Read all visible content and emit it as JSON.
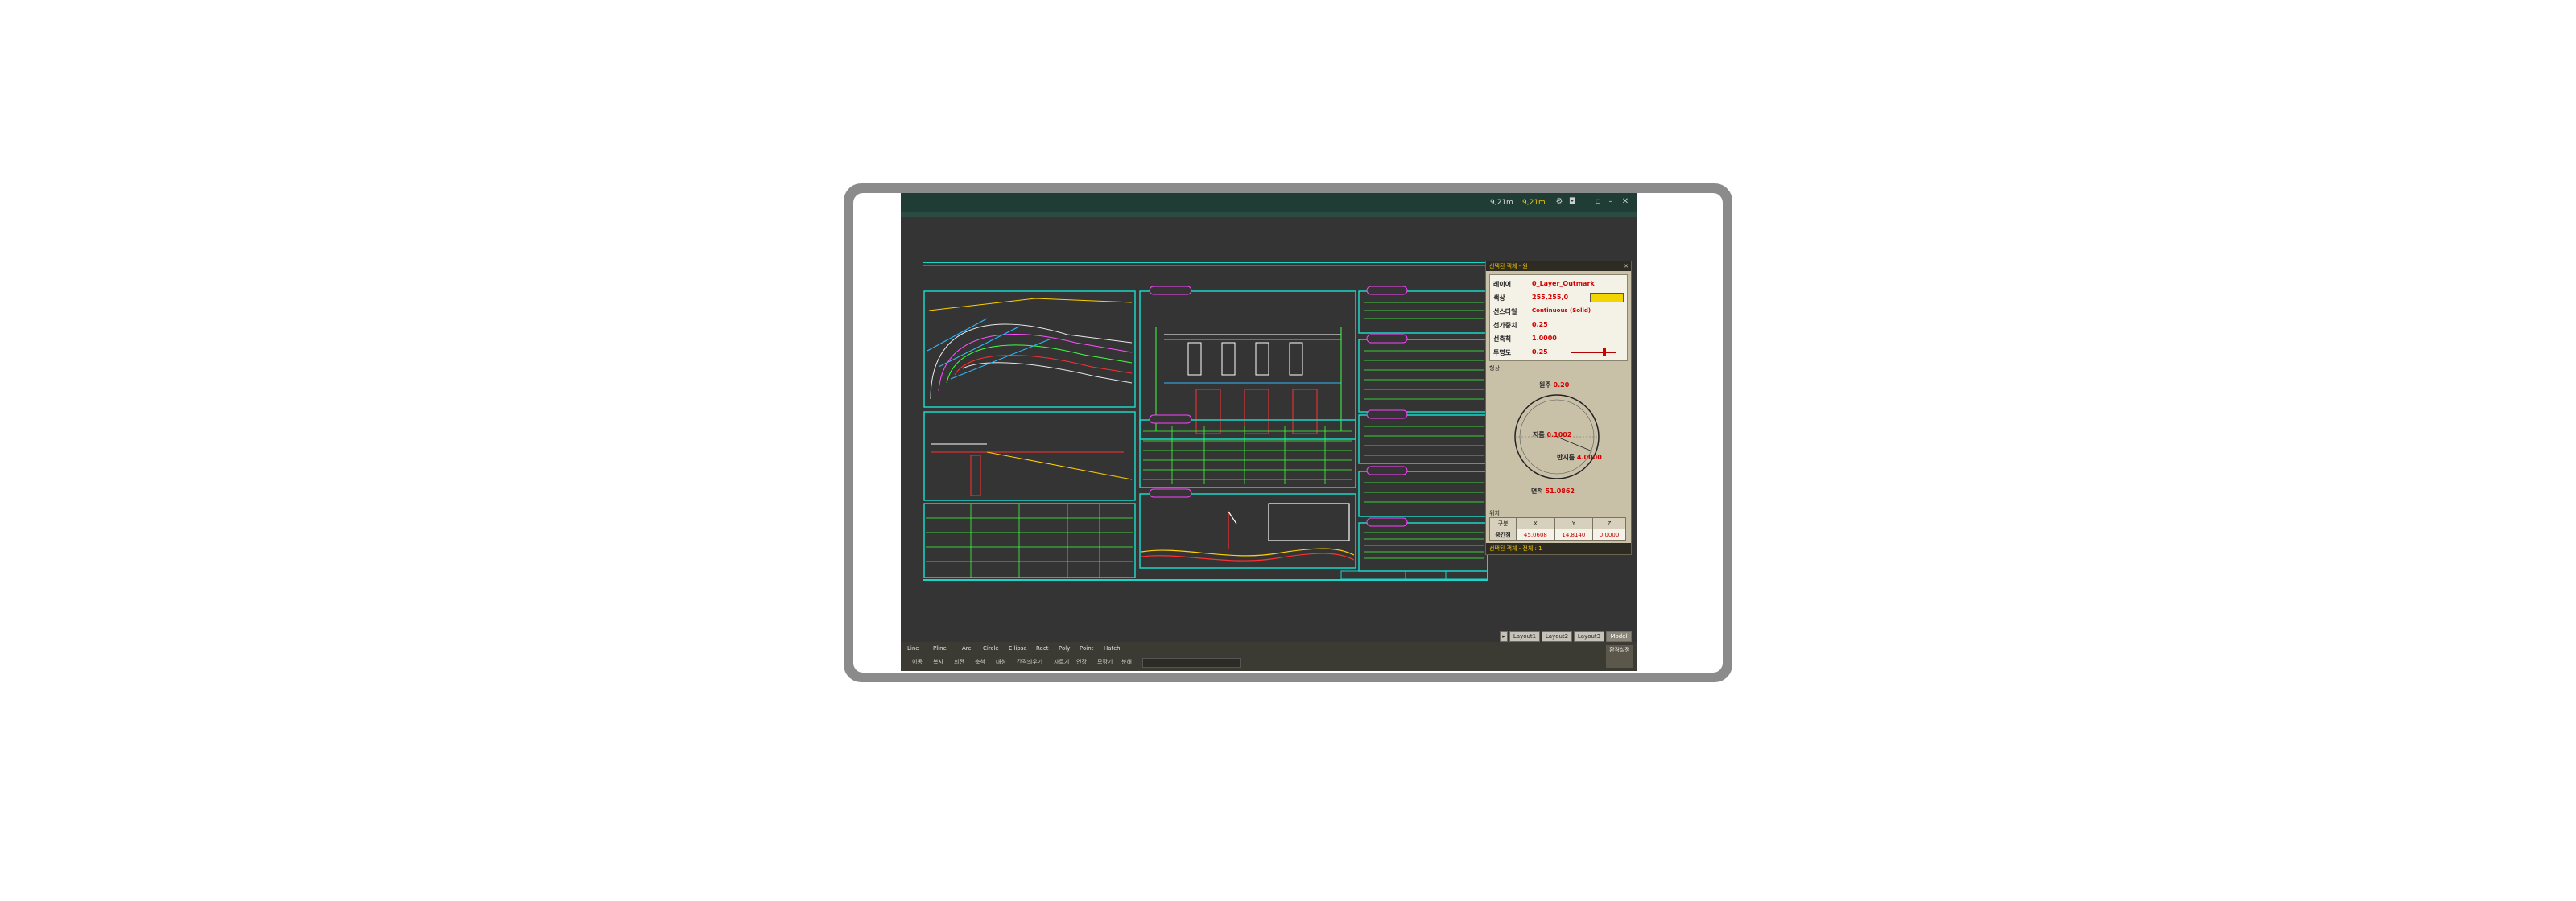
{
  "window": {
    "status_left": "9,21m",
    "status_right": "9,21m"
  },
  "panel": {
    "title": "선택된 객체 - 원",
    "properties": [
      {
        "key": "레이어",
        "value": "0_Layer_Outmark"
      },
      {
        "key": "색상",
        "value": "255,255,0"
      },
      {
        "key": "선스타일",
        "value": "Continuous (Solid)"
      },
      {
        "key": "선가중치",
        "value": "0.25"
      },
      {
        "key": "선축척",
        "value": "1.0000"
      },
      {
        "key": "투명도",
        "value": "0.25"
      }
    ],
    "color_swatch": "#f2d500",
    "section_geometry": "형상",
    "diameter_label": "원주",
    "diameter_value": "0.20",
    "center_label": "지름",
    "center_value": "0.1002",
    "radius_label": "반지름",
    "radius_value": "4.0000",
    "area_label": "면적",
    "area_value": "51.0862",
    "section_position": "위치",
    "table": {
      "headers": [
        "구분",
        "X",
        "Y",
        "Z"
      ],
      "row": [
        "중간점",
        "45.0608",
        "14.8140",
        "0.0000"
      ]
    },
    "footer": "선택된 객체 - 전체 : 1"
  },
  "tabs": [
    "Layout1",
    "Layout2",
    "Layout3"
  ],
  "model_tab": "Model",
  "menu": {
    "row1": [
      "Line",
      "Pline",
      "Arc",
      "Circle",
      "Ellipse",
      "Rect",
      "Poly",
      "Point",
      "Hatch"
    ],
    "row2": [
      "이동",
      "복사",
      "회전",
      "축척",
      "대칭",
      "간격띄우기",
      "자르기",
      "연장",
      "모깎기",
      "분해"
    ],
    "corner": "환경설정"
  }
}
